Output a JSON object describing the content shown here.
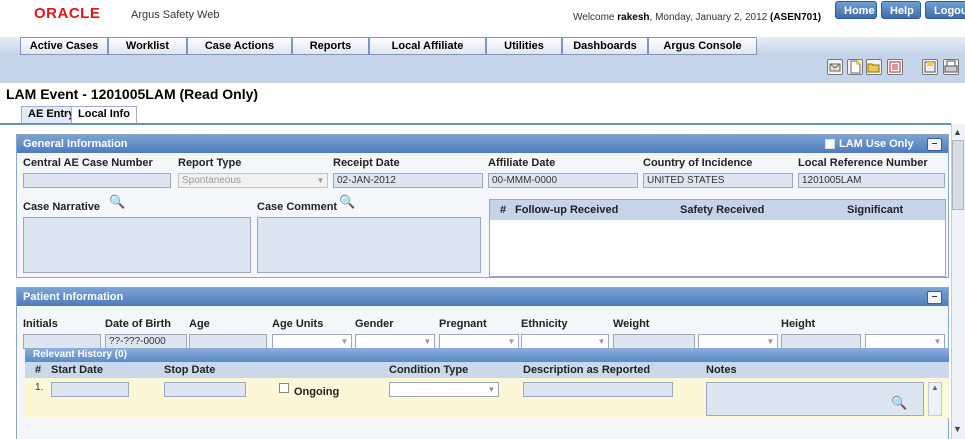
{
  "header": {
    "logo": "ORACLE",
    "app_title": "Argus Safety Web",
    "welcome_prefix": "Welcome ",
    "user": "rakesh",
    "welcome_suffix": ", Monday, January 2, 2012",
    "session": "(ASEN701)",
    "links": [
      "Home",
      "Help",
      "Logout"
    ]
  },
  "menu": [
    "Active Cases",
    "Worklist",
    "Case Actions",
    "Reports",
    "Local Affiliate",
    "Utilities",
    "Dashboards",
    "Argus Console"
  ],
  "toolbar": {
    "icons": [
      "envelope-icon",
      "new-document-icon",
      "open-folder-icon",
      "list-icon",
      "save-icon",
      "print-icon"
    ]
  },
  "page": {
    "title": "LAM Event - 1201005LAM (Read Only)"
  },
  "tabs": [
    "AE Entry",
    "Local Info"
  ],
  "general": {
    "title": "General Information",
    "lam_use_only": "LAM Use Only",
    "labels": {
      "central_ae": "Central AE Case Number",
      "report_type": "Report Type",
      "receipt_date": "Receipt Date",
      "affiliate_date": "Affiliate Date",
      "country": "Country of Incidence",
      "local_ref": "Local Reference Number",
      "case_narrative": "Case Narrative",
      "case_comment": "Case Comment"
    },
    "values": {
      "central_ae": "",
      "report_type": "Spontaneous",
      "receipt_date": "02-JAN-2012",
      "affiliate_date": "00-MMM-0000",
      "country": "UNITED STATES",
      "local_ref": "1201005LAM"
    },
    "followup_columns": [
      "#",
      "Follow-up Received",
      "Safety Received",
      "Significant"
    ]
  },
  "patient": {
    "title": "Patient Information",
    "labels": {
      "initials": "Initials",
      "dob": "Date of Birth",
      "age": "Age",
      "age_units": "Age Units",
      "gender": "Gender",
      "pregnant": "Pregnant",
      "ethnicity": "Ethnicity",
      "weight": "Weight",
      "height": "Height"
    },
    "values": {
      "dob": "??-???-0000"
    },
    "history": {
      "title": "Relevant History (0)",
      "columns": [
        "#",
        "Start Date",
        "Stop Date",
        "Condition Type",
        "Description as Reported",
        "Notes"
      ],
      "row_number": "1.",
      "ongoing_label": "Ongoing"
    }
  },
  "colors": {
    "accent": "#4d7cbb",
    "oracle_red": "#e0161c",
    "tool_band": "#c6d4e9",
    "history_row": "#fbf7d7"
  }
}
